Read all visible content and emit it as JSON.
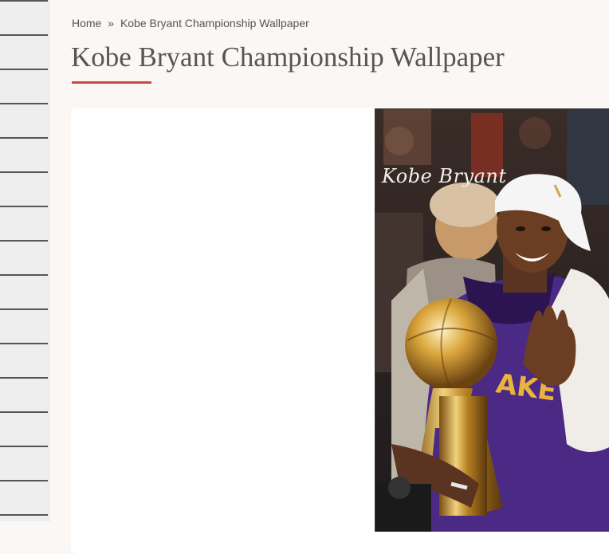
{
  "breadcrumb": {
    "home": "Home",
    "separator": "»",
    "current": "Kobe Bryant Championship Wallpaper"
  },
  "page": {
    "title": "Kobe Bryant Championship Wallpaper"
  },
  "wallpaper": {
    "alt": "Kobe Bryant Championship Wallpaper",
    "signature": "Kobe Bryant",
    "jersey_text": "AKE"
  },
  "colors": {
    "accent": "#c84b3f",
    "page_bg": "#fbf7f4",
    "text": "#555555"
  }
}
